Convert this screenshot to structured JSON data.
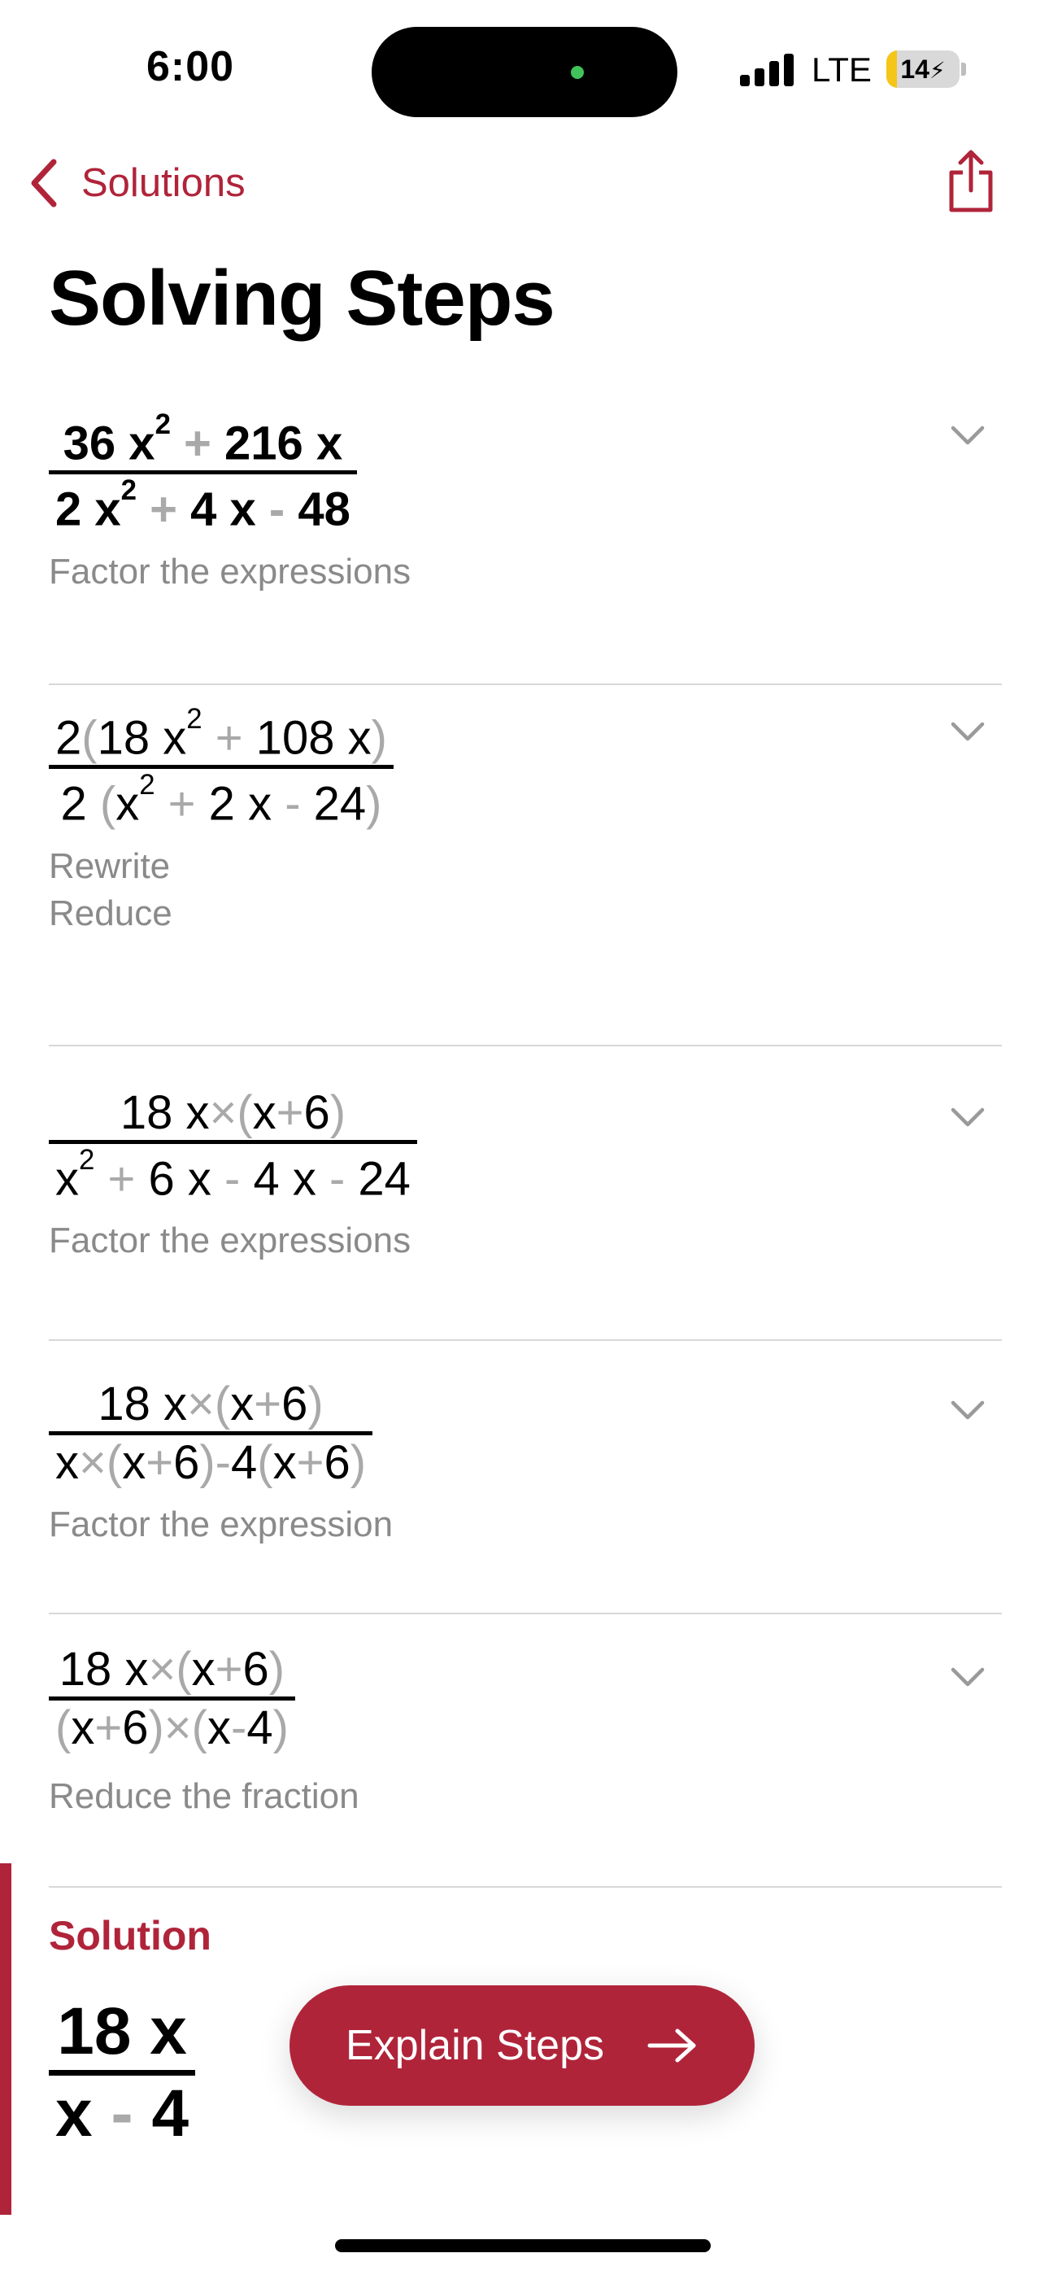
{
  "status_bar": {
    "time": "6:00",
    "network": "LTE",
    "battery_level": "14",
    "battery_level_fraction": 0.14,
    "battery_color": "#f5c518"
  },
  "nav": {
    "back_label": "Solutions",
    "back_icon": "chevron-left-icon",
    "share_icon": "share-icon"
  },
  "title": "Solving Steps",
  "accent_color": "#b0243a",
  "steps": [
    {
      "numerator": [
        "36",
        "x",
        "2",
        "+",
        "216",
        "x"
      ],
      "denominator": [
        "2",
        "x",
        "2",
        "+",
        "4",
        "x",
        "-",
        "48"
      ],
      "desc": [
        "Factor the expressions"
      ]
    },
    {
      "numerator": [
        "2",
        "(",
        "18",
        "x",
        "2",
        "+",
        "108",
        "x",
        ")"
      ],
      "denominator": [
        "2",
        "(",
        "x",
        "2",
        "+",
        "2",
        "x",
        "-",
        "24",
        ")"
      ],
      "desc": [
        "Rewrite",
        "Reduce"
      ]
    },
    {
      "numerator": [
        "18",
        "x",
        "×",
        "(",
        "x",
        "+",
        "6",
        ")"
      ],
      "denominator": [
        "x",
        "2",
        "+",
        "6",
        "x",
        "-",
        "4",
        "x",
        "-",
        "24"
      ],
      "desc": [
        "Factor the expressions"
      ]
    },
    {
      "numerator": [
        "18",
        "x",
        "×",
        "(",
        "x",
        "+",
        "6",
        ")"
      ],
      "denominator": [
        "x",
        "×",
        "(",
        "x",
        "+",
        "6",
        ")",
        "-",
        "4",
        "(",
        "x",
        "+",
        "6",
        ")"
      ],
      "desc": [
        "Factor the expression"
      ]
    },
    {
      "numerator": [
        "18",
        "x",
        "×",
        "(",
        "x",
        "+",
        "6",
        ")"
      ],
      "denominator": [
        "(",
        "x",
        "+",
        "6",
        ")",
        "×",
        "(",
        "x",
        "-",
        "4",
        ")"
      ],
      "desc": [
        "Reduce the fraction"
      ]
    }
  ],
  "solution": {
    "label": "Solution",
    "numerator": [
      "18",
      "x"
    ],
    "denominator": [
      "x",
      "-",
      "4"
    ]
  },
  "explain_button": {
    "label": "Explain Steps",
    "icon": "arrow-right-icon"
  }
}
